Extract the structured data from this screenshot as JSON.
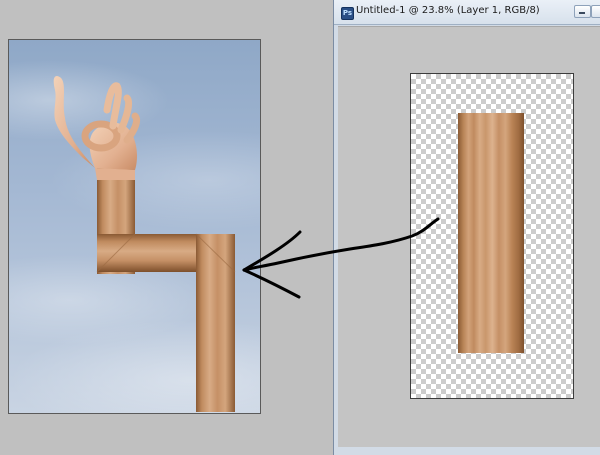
{
  "document_window": {
    "title": "Untitled-1 @ 23.8% (Layer 1, RGB/8)",
    "app_icon": "photoshop-document-icon",
    "buttons": [
      "minimize-button",
      "maximize-button"
    ]
  },
  "left_image": {
    "content": [
      "sky-background",
      "hand-ok-gesture",
      "bent-wooden-arm"
    ]
  },
  "canvas": {
    "background": "transparency-checkerboard",
    "layer_content": "wood-grain-rectangle"
  },
  "annotation": {
    "type": "hand-drawn-arrow",
    "color": "#000000"
  },
  "colors": {
    "wood_light": "#d8ab85",
    "wood_dark": "#8a5a34",
    "sky": "#a4b8d3",
    "window_frame": "#d2dbe6"
  }
}
